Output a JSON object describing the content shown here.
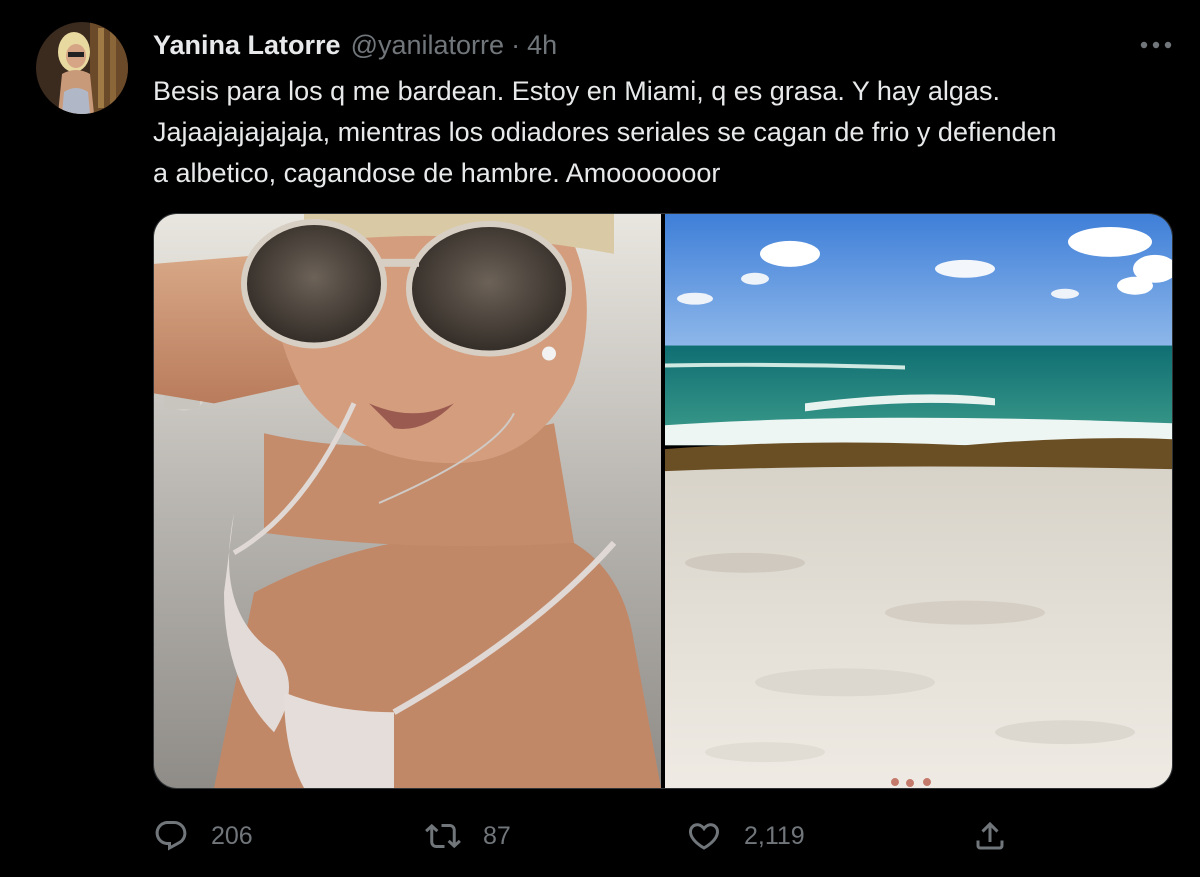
{
  "tweet": {
    "author": {
      "display_name": "Yanina Latorre",
      "handle": "@yanilatorre",
      "separator": "·",
      "time": "4h"
    },
    "text_lines": [
      "Besis para los q me bardean. Estoy en Miami, q es grasa. Y hay algas.",
      "Jajaajajajajaja, mientras los odiadores seriales se cagan de frio y defienden",
      "a albetico, cagandose de hambre. Amooooooor"
    ],
    "media": [
      {
        "kind": "photo",
        "subject": "selfie-on-beach"
      },
      {
        "kind": "photo",
        "subject": "beach-with-sea-and-algae"
      }
    ],
    "actions": {
      "reply": {
        "icon": "reply-icon",
        "count": "206"
      },
      "retweet": {
        "icon": "retweet-icon",
        "count": "87"
      },
      "like": {
        "icon": "like-icon",
        "count": "2,119"
      },
      "share": {
        "icon": "share-icon"
      }
    },
    "more_icon": "more-icon"
  },
  "colors": {
    "background": "#000000",
    "text_primary": "#e7e9ea",
    "text_secondary": "#71767b",
    "border": "#2f3336"
  }
}
